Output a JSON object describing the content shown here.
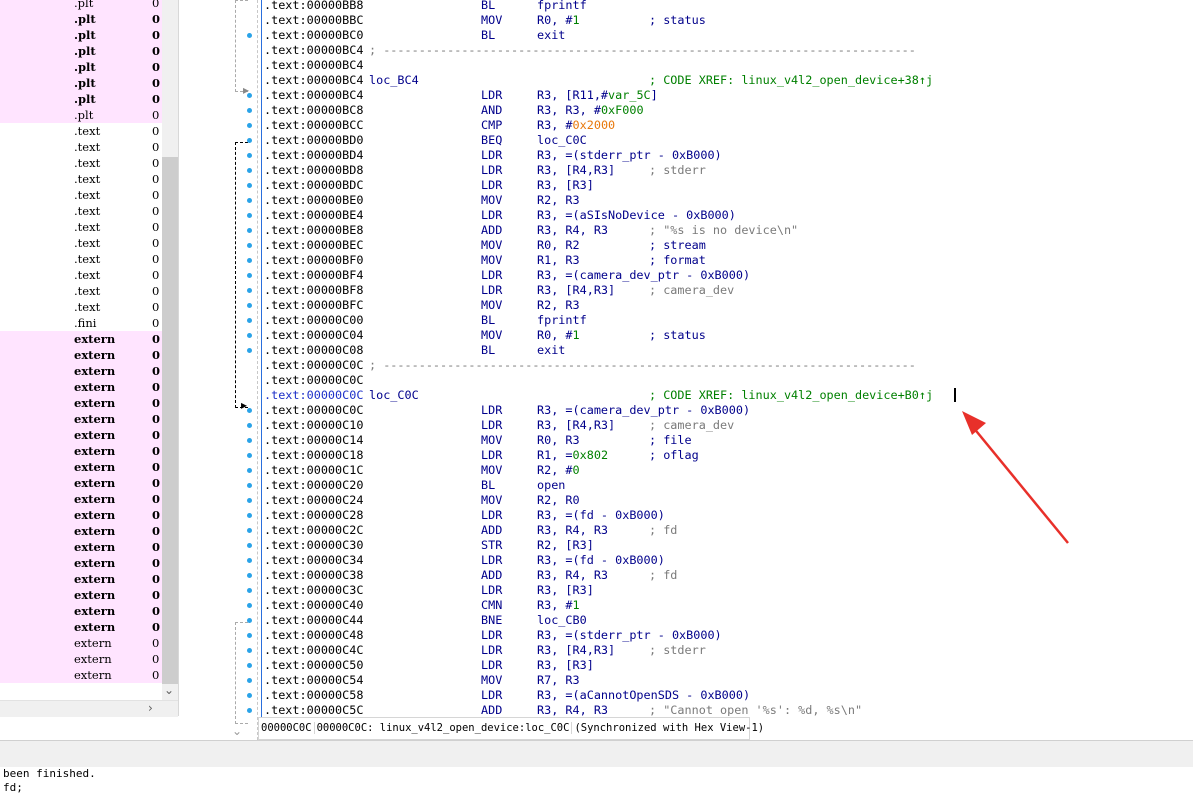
{
  "segments": [
    {
      "name": ".plt",
      "val": "0",
      "pink": true,
      "bold": false
    },
    {
      "name": ".plt",
      "val": "0",
      "pink": true,
      "bold": true
    },
    {
      "name": ".plt",
      "val": "0",
      "pink": true,
      "bold": true
    },
    {
      "name": ".plt",
      "val": "0",
      "pink": true,
      "bold": true
    },
    {
      "name": ".plt",
      "val": "0",
      "pink": true,
      "bold": true
    },
    {
      "name": ".plt",
      "val": "0",
      "pink": true,
      "bold": true
    },
    {
      "name": ".plt",
      "val": "0",
      "pink": true,
      "bold": true
    },
    {
      "name": ".plt",
      "val": "0",
      "pink": true,
      "bold": false
    },
    {
      "name": ".text",
      "val": "0",
      "pink": false,
      "bold": false
    },
    {
      "name": ".text",
      "val": "0",
      "pink": false,
      "bold": false
    },
    {
      "name": ".text",
      "val": "0",
      "pink": false,
      "bold": false
    },
    {
      "name": ".text",
      "val": "0",
      "pink": false,
      "bold": false
    },
    {
      "name": ".text",
      "val": "0",
      "pink": false,
      "bold": false
    },
    {
      "name": ".text",
      "val": "0",
      "pink": false,
      "bold": false
    },
    {
      "name": ".text",
      "val": "0",
      "pink": false,
      "bold": false
    },
    {
      "name": ".text",
      "val": "0",
      "pink": false,
      "bold": false
    },
    {
      "name": ".text",
      "val": "0",
      "pink": false,
      "bold": false
    },
    {
      "name": ".text",
      "val": "0",
      "pink": false,
      "bold": false
    },
    {
      "name": ".text",
      "val": "0",
      "pink": false,
      "bold": false
    },
    {
      "name": ".text",
      "val": "0",
      "pink": false,
      "bold": false
    },
    {
      "name": ".fini",
      "val": "0",
      "pink": false,
      "bold": false
    },
    {
      "name": "extern",
      "val": "0",
      "pink": true,
      "bold": true
    },
    {
      "name": "extern",
      "val": "0",
      "pink": true,
      "bold": true
    },
    {
      "name": "extern",
      "val": "0",
      "pink": true,
      "bold": true
    },
    {
      "name": "extern",
      "val": "0",
      "pink": true,
      "bold": true
    },
    {
      "name": "extern",
      "val": "0",
      "pink": true,
      "bold": true
    },
    {
      "name": "extern",
      "val": "0",
      "pink": true,
      "bold": true
    },
    {
      "name": "extern",
      "val": "0",
      "pink": true,
      "bold": true
    },
    {
      "name": "extern",
      "val": "0",
      "pink": true,
      "bold": true
    },
    {
      "name": "extern",
      "val": "0",
      "pink": true,
      "bold": true
    },
    {
      "name": "extern",
      "val": "0",
      "pink": true,
      "bold": true
    },
    {
      "name": "extern",
      "val": "0",
      "pink": true,
      "bold": true
    },
    {
      "name": "extern",
      "val": "0",
      "pink": true,
      "bold": true
    },
    {
      "name": "extern",
      "val": "0",
      "pink": true,
      "bold": true
    },
    {
      "name": "extern",
      "val": "0",
      "pink": true,
      "bold": true
    },
    {
      "name": "extern",
      "val": "0",
      "pink": true,
      "bold": true
    },
    {
      "name": "extern",
      "val": "0",
      "pink": true,
      "bold": true
    },
    {
      "name": "extern",
      "val": "0",
      "pink": true,
      "bold": true
    },
    {
      "name": "extern",
      "val": "0",
      "pink": true,
      "bold": true
    },
    {
      "name": "extern",
      "val": "0",
      "pink": true,
      "bold": true
    },
    {
      "name": "extern",
      "val": "0",
      "pink": true,
      "bold": false
    },
    {
      "name": "extern",
      "val": "0",
      "pink": true,
      "bold": false
    },
    {
      "name": "extern",
      "val": "0",
      "pink": true,
      "bold": false
    }
  ],
  "disasm": [
    {
      "addr": ".text:00000BB8",
      "mnem": "BL",
      "ops": "fprintf"
    },
    {
      "addr": ".text:00000BBC",
      "mnem": "MOV",
      "ops": "R0, #1",
      "cmt": "; status",
      "cmt_style": "blue"
    },
    {
      "addr": ".text:00000BC0",
      "mnem": "BL",
      "ops": "exit"
    },
    {
      "addr": ".text:00000BC4",
      "sep": "; ---------------------------------------------------------------------------"
    },
    {
      "addr": ".text:00000BC4"
    },
    {
      "addr": ".text:00000BC4",
      "label": "loc_BC4",
      "cmt": "; CODE XREF: linux_v4l2_open_device+38↑j",
      "cmt_style": "green"
    },
    {
      "addr": ".text:00000BC4",
      "mnem": "LDR",
      "ops": "R3, [R11,#var_5C]"
    },
    {
      "addr": ".text:00000BC8",
      "mnem": "AND",
      "ops": "R3, R3, #0xF000"
    },
    {
      "addr": ".text:00000BCC",
      "mnem": "CMP",
      "ops": "R3, #0x2000"
    },
    {
      "addr": ".text:00000BD0",
      "mnem": "BEQ",
      "ops": "loc_C0C"
    },
    {
      "addr": ".text:00000BD4",
      "mnem": "LDR",
      "ops": "R3, =(stderr_ptr - 0xB000)"
    },
    {
      "addr": ".text:00000BD8",
      "mnem": "LDR",
      "ops": "R3, [R4,R3]",
      "cmt": "; stderr",
      "cmt_style": "grey"
    },
    {
      "addr": ".text:00000BDC",
      "mnem": "LDR",
      "ops": "R3, [R3]"
    },
    {
      "addr": ".text:00000BE0",
      "mnem": "MOV",
      "ops": "R2, R3"
    },
    {
      "addr": ".text:00000BE4",
      "mnem": "LDR",
      "ops": "R3, =(aSIsNoDevice - 0xB000)"
    },
    {
      "addr": ".text:00000BE8",
      "mnem": "ADD",
      "ops": "R3, R4, R3",
      "cmt": "; \"%s is no device\\n\"",
      "cmt_style": "grey"
    },
    {
      "addr": ".text:00000BEC",
      "mnem": "MOV",
      "ops": "R0, R2",
      "cmt": "; stream",
      "cmt_style": "blue"
    },
    {
      "addr": ".text:00000BF0",
      "mnem": "MOV",
      "ops": "R1, R3",
      "cmt": "; format",
      "cmt_style": "blue"
    },
    {
      "addr": ".text:00000BF4",
      "mnem": "LDR",
      "ops": "R3, =(camera_dev_ptr - 0xB000)"
    },
    {
      "addr": ".text:00000BF8",
      "mnem": "LDR",
      "ops": "R3, [R4,R3]",
      "cmt": "; camera_dev",
      "cmt_style": "grey"
    },
    {
      "addr": ".text:00000BFC",
      "mnem": "MOV",
      "ops": "R2, R3"
    },
    {
      "addr": ".text:00000C00",
      "mnem": "BL",
      "ops": "fprintf"
    },
    {
      "addr": ".text:00000C04",
      "mnem": "MOV",
      "ops": "R0, #1",
      "cmt": "; status",
      "cmt_style": "blue"
    },
    {
      "addr": ".text:00000C08",
      "mnem": "BL",
      "ops": "exit"
    },
    {
      "addr": ".text:00000C0C",
      "sep": "; ---------------------------------------------------------------------------"
    },
    {
      "addr": ".text:00000C0C"
    },
    {
      "addr": ".text:00000C0C",
      "label": "loc_C0C",
      "cmt": "; CODE XREF: linux_v4l2_open_device+B0↑j",
      "cmt_style": "green",
      "current": true
    },
    {
      "addr": ".text:00000C0C",
      "mnem": "LDR",
      "ops": "R3, =(camera_dev_ptr - 0xB000)"
    },
    {
      "addr": ".text:00000C10",
      "mnem": "LDR",
      "ops": "R3, [R4,R3]",
      "cmt": "; camera_dev",
      "cmt_style": "grey"
    },
    {
      "addr": ".text:00000C14",
      "mnem": "MOV",
      "ops": "R0, R3",
      "cmt": "; file",
      "cmt_style": "blue"
    },
    {
      "addr": ".text:00000C18",
      "mnem": "LDR",
      "ops": "R1, =0x802",
      "cmt": "; oflag",
      "cmt_style": "blue"
    },
    {
      "addr": ".text:00000C1C",
      "mnem": "MOV",
      "ops": "R2, #0"
    },
    {
      "addr": ".text:00000C20",
      "mnem": "BL",
      "ops": "open"
    },
    {
      "addr": ".text:00000C24",
      "mnem": "MOV",
      "ops": "R2, R0"
    },
    {
      "addr": ".text:00000C28",
      "mnem": "LDR",
      "ops": "R3, =(fd - 0xB000)"
    },
    {
      "addr": ".text:00000C2C",
      "mnem": "ADD",
      "ops": "R3, R4, R3",
      "cmt": "; fd",
      "cmt_style": "grey",
      "cmt_short": true
    },
    {
      "addr": ".text:00000C30",
      "mnem": "STR",
      "ops": "R2, [R3]"
    },
    {
      "addr": ".text:00000C34",
      "mnem": "LDR",
      "ops": "R3, =(fd - 0xB000)"
    },
    {
      "addr": ".text:00000C38",
      "mnem": "ADD",
      "ops": "R3, R4, R3",
      "cmt": "; fd",
      "cmt_style": "grey",
      "cmt_short": true
    },
    {
      "addr": ".text:00000C3C",
      "mnem": "LDR",
      "ops": "R3, [R3]"
    },
    {
      "addr": ".text:00000C40",
      "mnem": "CMN",
      "ops": "R3, #1"
    },
    {
      "addr": ".text:00000C44",
      "mnem": "BNE",
      "ops": "loc_CB0"
    },
    {
      "addr": ".text:00000C48",
      "mnem": "LDR",
      "ops": "R3, =(stderr_ptr - 0xB000)"
    },
    {
      "addr": ".text:00000C4C",
      "mnem": "LDR",
      "ops": "R3, [R4,R3]",
      "cmt": "; stderr",
      "cmt_style": "grey"
    },
    {
      "addr": ".text:00000C50",
      "mnem": "LDR",
      "ops": "R3, [R3]"
    },
    {
      "addr": ".text:00000C54",
      "mnem": "MOV",
      "ops": "R7, R3"
    },
    {
      "addr": ".text:00000C58",
      "mnem": "LDR",
      "ops": "R3, =(aCannotOpenSDS - 0xB000)"
    },
    {
      "addr": ".text:00000C5C",
      "mnem": "ADD",
      "ops": "R3, R4, R3",
      "cmt": "; \"Cannot open '%s': %d, %s\\n\"",
      "cmt_style": "grey"
    }
  ],
  "status": {
    "offset": "00000C0C",
    "location": "00000C0C: linux_v4l2_open_device:loc_C0C",
    "sync": "(Synchronized with Hex View-1)"
  },
  "output": {
    "line1": "been finished.",
    "line2": "fd;"
  },
  "colors": {
    "segment_pink": "#ffe4ff",
    "instruction_blue": "#00008b",
    "xref_green": "#008000",
    "comment_grey": "#7a7a7a",
    "hex_orange": "#e8770a",
    "annotation_red": "#e8302a",
    "flow_dot": "#2aa3e8"
  }
}
